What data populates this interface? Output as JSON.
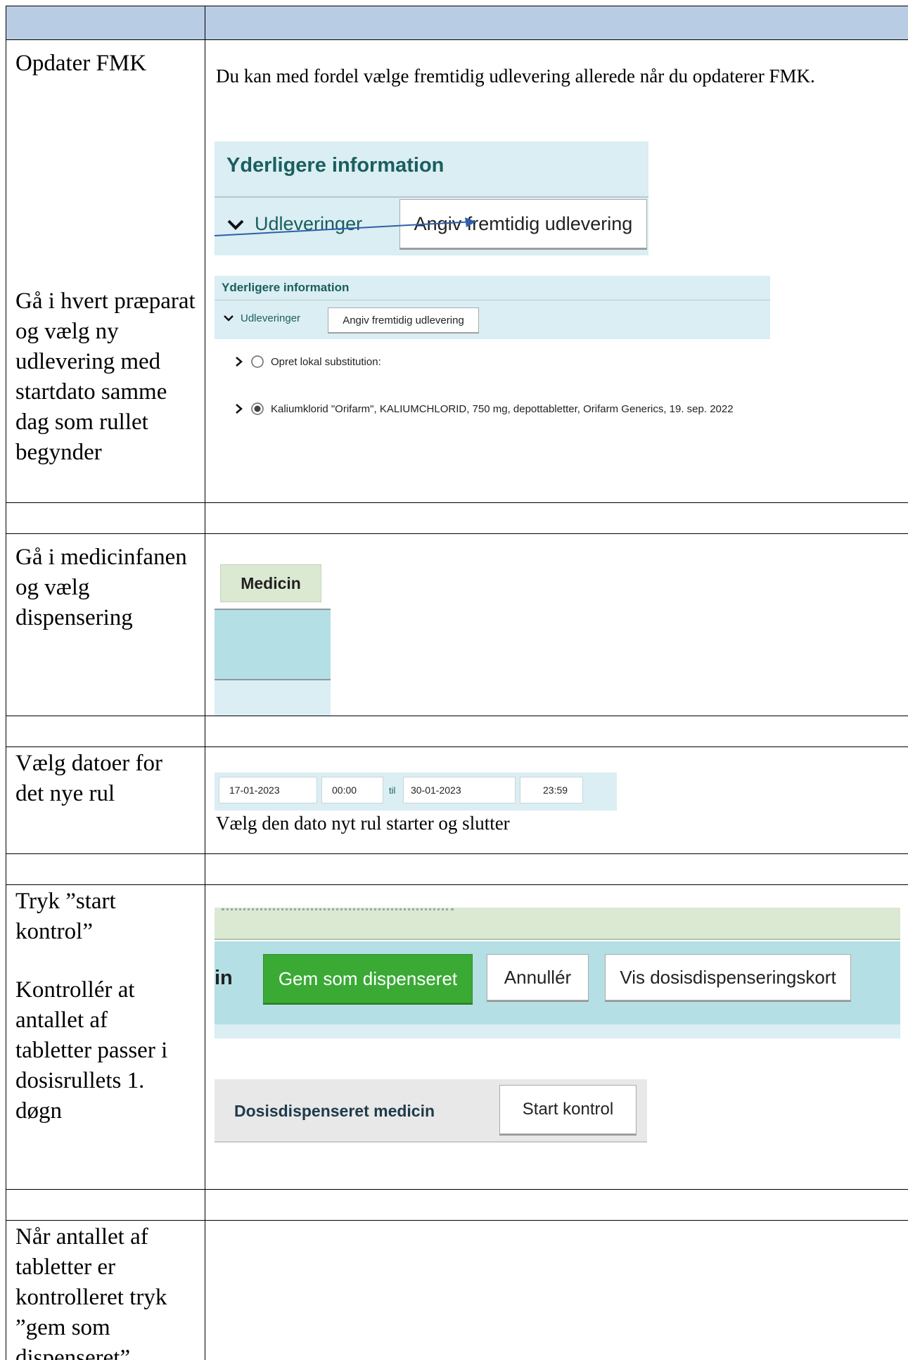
{
  "rows": [
    {
      "label": "Opdater FMK",
      "description": "Du kan med fordel vælge fremtidig udlevering allerede når du opdaterer FMK.",
      "shot": {
        "heading": "Yderligere information",
        "section": "Udleveringer",
        "button": "Angiv fremtidig udlevering"
      }
    },
    {
      "label": "Gå i hvert præparat og vælg ny udlevering med startdato samme dag som rullet begynder",
      "shot": {
        "heading": "Yderligere information",
        "section": "Udleveringer",
        "button": "Angiv fremtidig udlevering",
        "option1": "Opret lokal substitution:",
        "option2": "Kaliumklorid \"Orifarm\", KALIUMCHLORID, 750 mg, depottabletter, Orifarm Generics, 19. sep. 2022"
      }
    },
    {
      "label": "Gå i medicinfanen og vælg dispensering",
      "shot": {
        "tab": "Medicin"
      }
    },
    {
      "label": "Vælg datoer for det nye rul",
      "shot": {
        "from_date": "17-01-2023",
        "from_time": "00:00",
        "til": "til",
        "to_date": "30-01-2023",
        "to_time": "23:59"
      },
      "caption": "Vælg den dato nyt rul starter og slutter"
    },
    {
      "label1": "Tryk ”start kontrol”",
      "label2": "Kontrollér at antallet af tabletter passer i dosisrullets 1. døgn",
      "shot": {
        "partial": "in",
        "save_button": "Gem som dispenseret",
        "cancel_button": "Annullér",
        "card_button": "Vis dosisdispenseringskort",
        "section": "Dosisdispenseret medicin",
        "start_button": "Start kontrol"
      }
    },
    {
      "label": "Når antallet af tabletter er kontrolleret tryk ”gem som dispenseret”"
    }
  ],
  "colors": {
    "header": "#b8cce4",
    "panel_blue": "#daeef3",
    "teal": "#1b5e5e",
    "green_button": "#3aaa35",
    "light_green": "#dbe9d3"
  }
}
